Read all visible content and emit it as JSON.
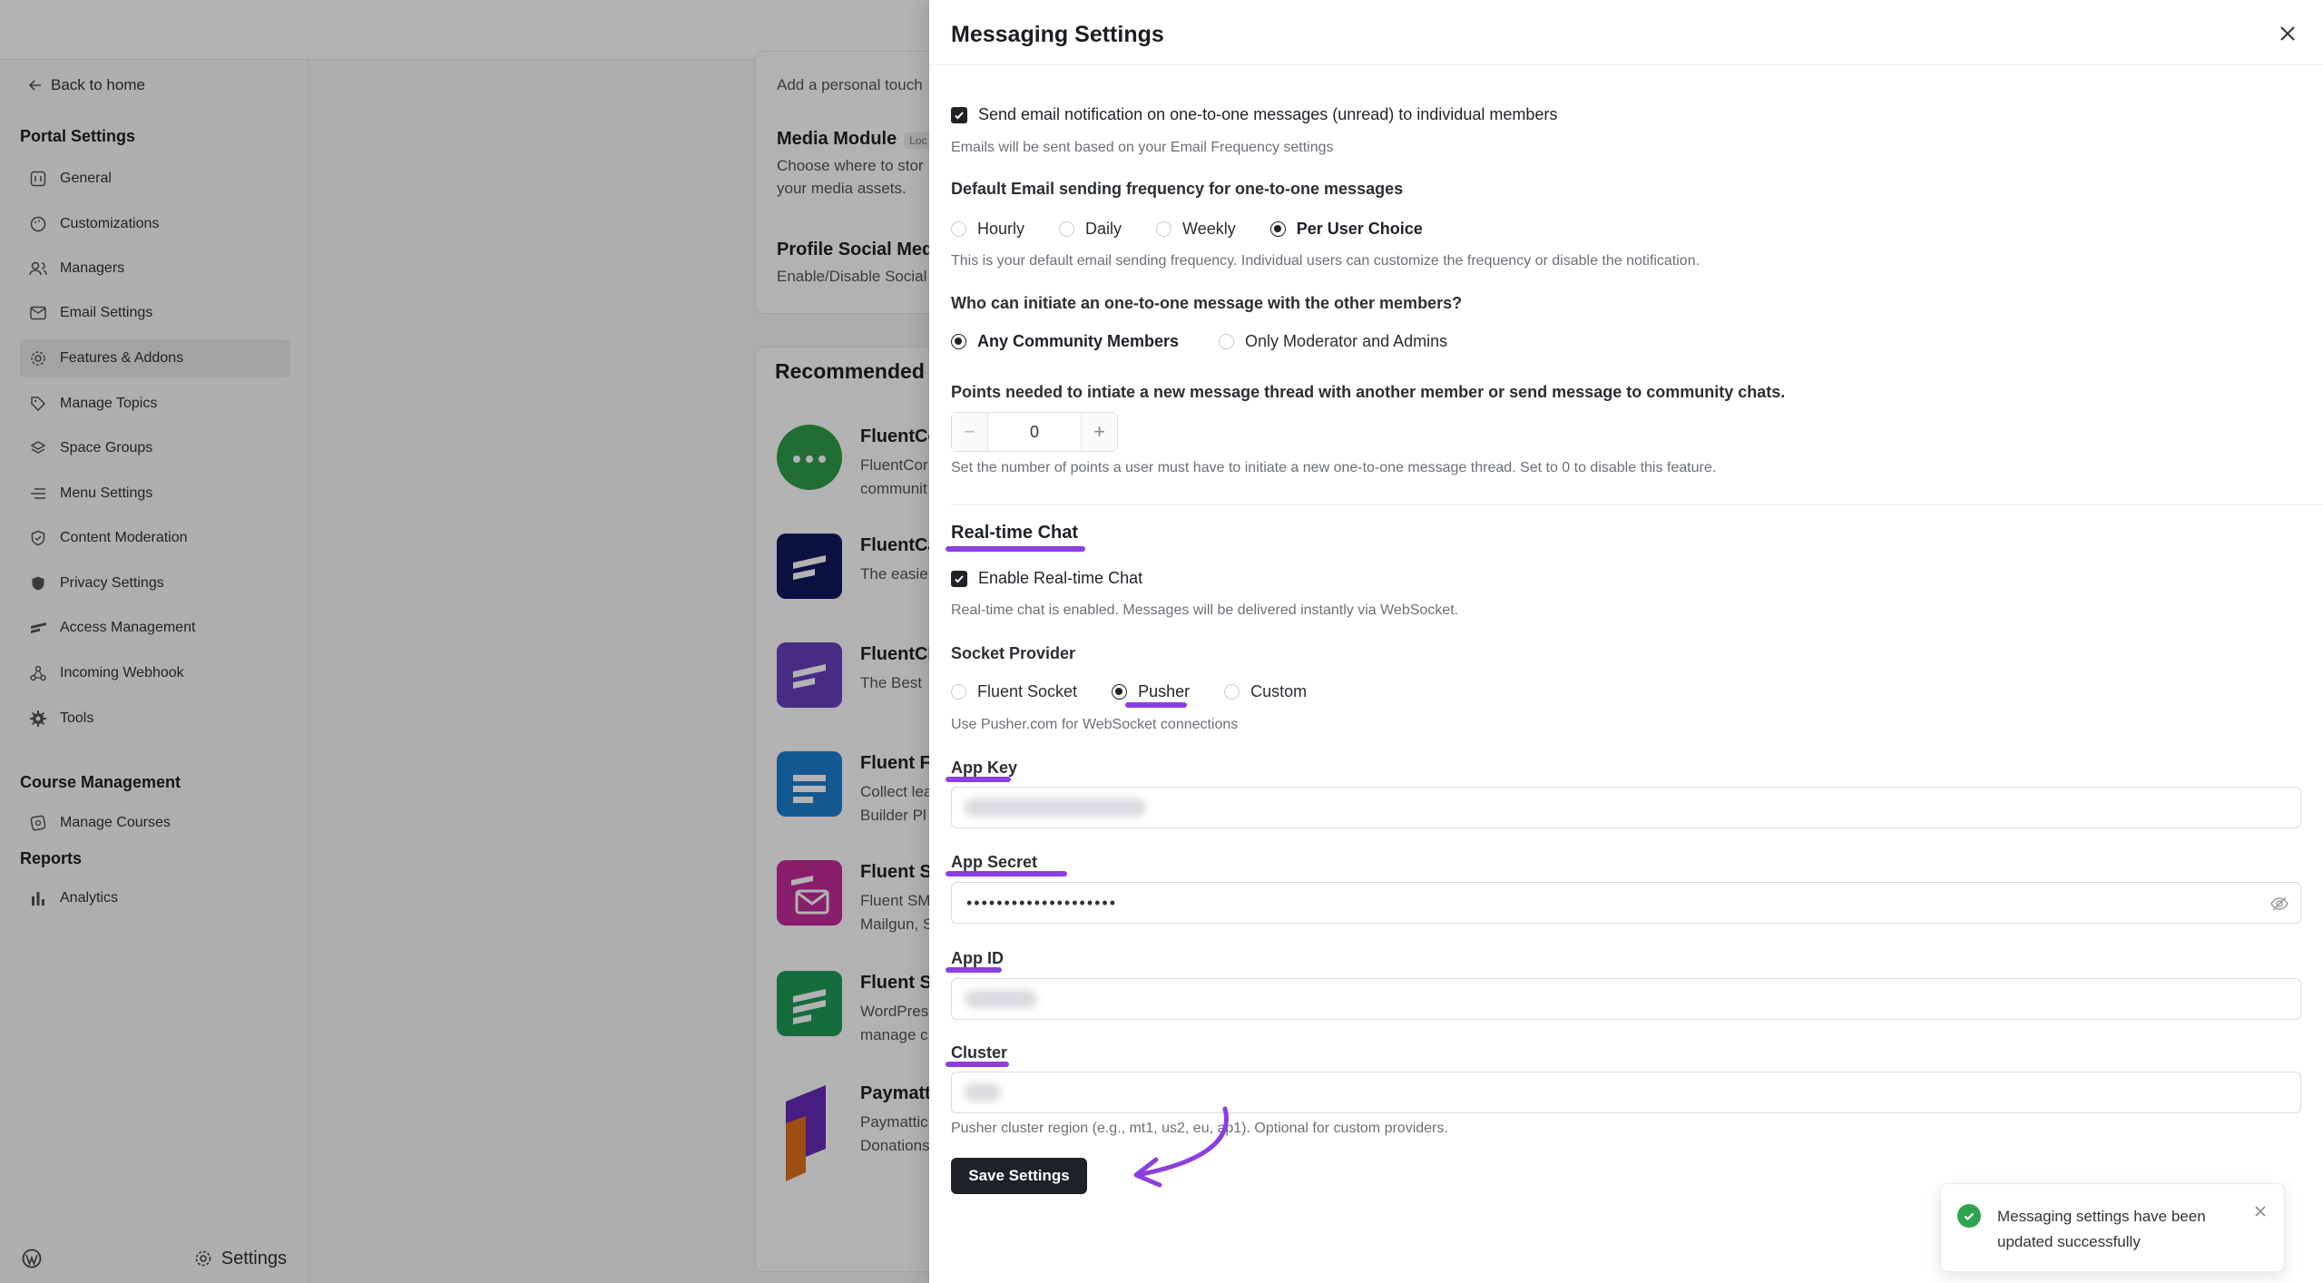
{
  "sidebar": {
    "back_label": "Back to home",
    "portal_section": "Portal Settings",
    "items": [
      {
        "label": "General"
      },
      {
        "label": "Customizations"
      },
      {
        "label": "Managers"
      },
      {
        "label": "Email Settings"
      },
      {
        "label": "Features & Addons"
      },
      {
        "label": "Manage Topics"
      },
      {
        "label": "Space Groups"
      },
      {
        "label": "Menu Settings"
      },
      {
        "label": "Content Moderation"
      },
      {
        "label": "Privacy Settings"
      },
      {
        "label": "Access Management"
      },
      {
        "label": "Incoming Webhook"
      },
      {
        "label": "Tools"
      }
    ],
    "course_section": "Course Management",
    "course_items": [
      {
        "label": "Manage Courses"
      }
    ],
    "reports_section": "Reports",
    "reports_items": [
      {
        "label": "Analytics"
      }
    ],
    "footer_settings": "Settings"
  },
  "content": {
    "partial_desc": "Add a personal touch",
    "media_title": "Media Module",
    "media_badge": "Loc",
    "media_desc_1": "Choose where to stor",
    "media_desc_2": "your media assets.",
    "social_title": "Profile Social Medi",
    "social_desc": "Enable/Disable Social",
    "recommended_title": "Recommended P",
    "plugins": [
      {
        "name": "FluentCo",
        "desc_1": "FluentCor",
        "desc_2": "communit",
        "color": "#2f9e4a"
      },
      {
        "name": "FluentCa",
        "desc_1": "The easie",
        "desc_2": "",
        "color": "#10195c"
      },
      {
        "name": "FluentCR",
        "desc_1": "The Best",
        "desc_2": "",
        "color": "#6a3fc1"
      },
      {
        "name": "Fluent Fo",
        "desc_1": "Collect lea",
        "desc_2": "Builder Pl",
        "color": "#1d7fd1"
      },
      {
        "name": "Fluent SI",
        "desc_1": "Fluent SM",
        "desc_2": "Mailgun, S",
        "color": "#c52d9b"
      },
      {
        "name": "Fluent Sn",
        "desc_1": "WordPres",
        "desc_2": "manage c",
        "color": "#1f9d5a"
      },
      {
        "name": "Paymatt",
        "desc_1": "Paymattic",
        "desc_2": "Donations",
        "color": "#6b2bb8"
      }
    ]
  },
  "drawer": {
    "title": "Messaging Settings",
    "email_notify_label": "Send email notification on one-to-one messages (unread) to individual members",
    "email_notify_help": "Emails will be sent based on your Email Frequency settings",
    "frequency_title": "Default Email sending frequency for one-to-one messages",
    "frequency_options": [
      "Hourly",
      "Daily",
      "Weekly",
      "Per User Choice"
    ],
    "frequency_selected": "Per User Choice",
    "frequency_help": "This is your default email sending frequency. Individual users can customize the frequency or disable the notification.",
    "initiate_title": "Who can initiate an one-to-one message with the other members?",
    "initiate_options": [
      "Any Community Members",
      "Only Moderator and Admins"
    ],
    "initiate_selected": "Any Community Members",
    "points_title": "Points needed to intiate a new message thread with another member or send message to community chats.",
    "points_value": "0",
    "points_help": "Set the number of points a user must have to initiate a new one-to-one message thread. Set to 0 to disable this feature.",
    "realtime_title": "Real-time Chat",
    "realtime_enable_label": "Enable Real-time Chat",
    "realtime_help": "Real-time chat is enabled. Messages will be delivered instantly via WebSocket.",
    "socket_title": "Socket Provider",
    "socket_options": [
      "Fluent Socket",
      "Pusher",
      "Custom"
    ],
    "socket_selected": "Pusher",
    "socket_help": "Use Pusher.com for WebSocket connections",
    "app_key_label": "App Key",
    "app_secret_label": "App Secret",
    "app_secret_value": "••••••••••••••••••••",
    "app_id_label": "App ID",
    "cluster_label": "Cluster",
    "cluster_help": "Pusher cluster region (e.g., mt1, us2, eu, ap1). Optional for custom providers.",
    "save_label": "Save Settings",
    "accent_color": "#8b3fe0"
  },
  "toast": {
    "message": "Messaging settings have been updated successfully"
  }
}
